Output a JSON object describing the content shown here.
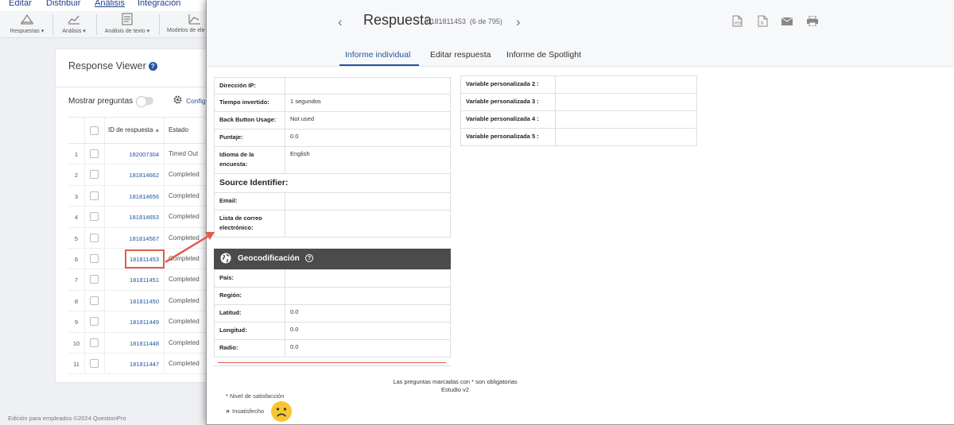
{
  "top_menu": [
    "Editar",
    "Distribuir",
    "Análisis",
    "Integración"
  ],
  "toolbar": [
    {
      "label": "Respuestas",
      "icon": "responses-icon"
    },
    {
      "label": "Análisis",
      "icon": "analysis-chart-icon"
    },
    {
      "label": "Análisis de texto",
      "icon": "text-analysis-icon"
    },
    {
      "label": "Modelos de ele",
      "icon": "models-chart-icon"
    }
  ],
  "viewer": {
    "title": "Response Viewer",
    "show_questions": "Mostrar preguntas",
    "config": "Config",
    "col_id": "ID de respuesta",
    "col_status": "Estado",
    "rows": [
      {
        "n": "1",
        "id": "182007304",
        "status": "Timed Out"
      },
      {
        "n": "2",
        "id": "181814662",
        "status": "Completed"
      },
      {
        "n": "3",
        "id": "181814656",
        "status": "Completed"
      },
      {
        "n": "4",
        "id": "181814653",
        "status": "Completed"
      },
      {
        "n": "5",
        "id": "181814567",
        "status": "Completed"
      },
      {
        "n": "6",
        "id": "181811453",
        "status": "Completed"
      },
      {
        "n": "7",
        "id": "181811451",
        "status": "Completed"
      },
      {
        "n": "8",
        "id": "181811450",
        "status": "Completed"
      },
      {
        "n": "9",
        "id": "181811449",
        "status": "Completed"
      },
      {
        "n": "10",
        "id": "181811448",
        "status": "Completed"
      },
      {
        "n": "11",
        "id": "181811447",
        "status": "Completed"
      }
    ]
  },
  "footer": "Edición para empleados ©2024 QuestionPro",
  "panel": {
    "title": "Respuesta",
    "id": "# 181811453",
    "count": "(6 de 795)",
    "tabs": [
      "Informe individual",
      "Editar respuesta",
      "Informe de Spotlight"
    ],
    "left_rows": [
      {
        "label": "Dirección IP:",
        "value": ""
      },
      {
        "label": "Tiempo invertido:",
        "value": "1 segundos"
      },
      {
        "label": "Back Button Usage:",
        "value": "Not used"
      },
      {
        "label": "Puntaje:",
        "value": "0.0"
      },
      {
        "label": "Idioma de la encuesta:",
        "value": "English"
      }
    ],
    "source_title": "Source Identifier:",
    "source_rows": [
      {
        "label": "Email:",
        "value": ""
      },
      {
        "label": "Lista de correo electrónico:",
        "value": ""
      }
    ],
    "geo_title": "Geocodificación",
    "geo_rows": [
      {
        "label": "País:",
        "value": ""
      },
      {
        "label": "Región:",
        "value": ""
      },
      {
        "label": "Latitud:",
        "value": "0.0"
      },
      {
        "label": "Longitud:",
        "value": "0.0"
      },
      {
        "label": "Radio:",
        "value": "0.0"
      }
    ],
    "right_rows": [
      {
        "label": "Variable personalizada 2 :",
        "value": ""
      },
      {
        "label": "Variable personalizada 3 :",
        "value": ""
      },
      {
        "label": "Variable personalizada 4 :",
        "value": ""
      },
      {
        "label": "Variable personalizada 5 :",
        "value": ""
      }
    ],
    "required_note": "Las preguntas marcadas con * son obligatorias",
    "study": "Estudio v2",
    "satisfaction_label": "* Nivel de satisfacción",
    "satisfaction_answer": "Insatisfecho"
  },
  "colors": {
    "accent": "#1e56a0",
    "highlight": "#e05a4f",
    "geo_header": "#4b4b4b"
  }
}
